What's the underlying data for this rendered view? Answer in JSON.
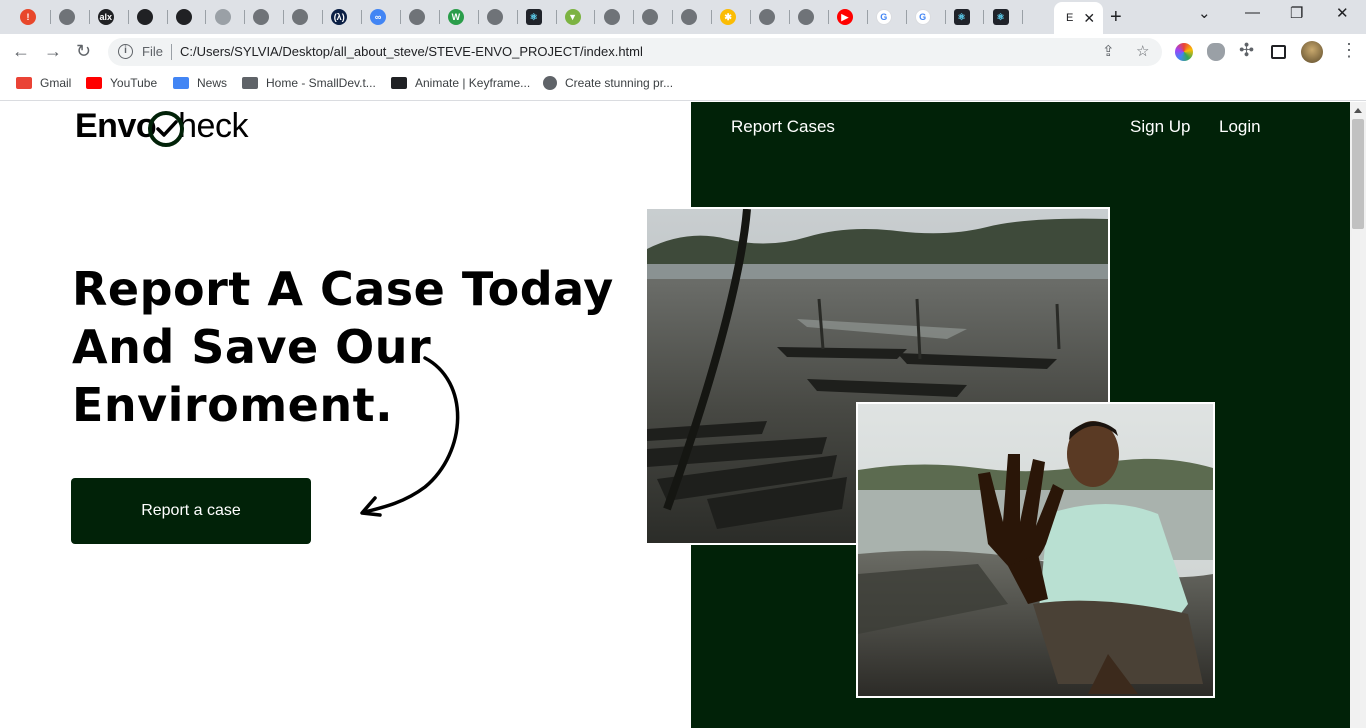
{
  "browser": {
    "active_tab_title": "E",
    "url_scheme_label": "File",
    "url": "C:/Users/SYLVIA/Desktop/all_about_steve/STEVE-ENVO_PROJECT/index.html",
    "tabs": [
      {
        "icon": "brave-icon",
        "color": "#e8472b",
        "glyph": "!"
      },
      {
        "icon": "globe-icon",
        "color": "#6f7378",
        "glyph": ""
      },
      {
        "icon": "alx-icon",
        "color": "#202124",
        "glyph": "alx"
      },
      {
        "icon": "github-icon",
        "color": "#202124",
        "glyph": ""
      },
      {
        "icon": "github-icon",
        "color": "#202124",
        "glyph": ""
      },
      {
        "icon": "figma-icon",
        "color": "#9aa0a6",
        "glyph": ""
      },
      {
        "icon": "globe-icon",
        "color": "#6f7378",
        "glyph": ""
      },
      {
        "icon": "globe-icon",
        "color": "#6f7378",
        "glyph": ""
      },
      {
        "icon": "codepen-icon",
        "color": "#0b1f44",
        "glyph": "(λ)"
      },
      {
        "icon": "infinity-icon",
        "color": "#4285f4",
        "glyph": "∞"
      },
      {
        "icon": "globe-icon",
        "color": "#6f7378",
        "glyph": ""
      },
      {
        "icon": "webflow-icon",
        "color": "#2a9d4a",
        "glyph": "W"
      },
      {
        "icon": "globe-icon",
        "color": "#6f7378",
        "glyph": ""
      },
      {
        "icon": "react-icon",
        "color": "#20232a",
        "glyph": "⚛"
      },
      {
        "icon": "download-icon",
        "color": "#7cb342",
        "glyph": "▼"
      },
      {
        "icon": "globe-icon",
        "color": "#6f7378",
        "glyph": ""
      },
      {
        "icon": "globe-icon",
        "color": "#6f7378",
        "glyph": ""
      },
      {
        "icon": "globe-icon",
        "color": "#6f7378",
        "glyph": ""
      },
      {
        "icon": "colorful-icon",
        "color": "#fbbc04",
        "glyph": "✱"
      },
      {
        "icon": "globe-icon",
        "color": "#6f7378",
        "glyph": ""
      },
      {
        "icon": "globe-icon",
        "color": "#6f7378",
        "glyph": ""
      },
      {
        "icon": "youtube-icon",
        "color": "#ff0000",
        "glyph": "▶"
      },
      {
        "icon": "google-icon",
        "color": "#ffffff",
        "glyph": "G"
      },
      {
        "icon": "google-icon",
        "color": "#ffffff",
        "glyph": "G"
      },
      {
        "icon": "react-icon",
        "color": "#20232a",
        "glyph": "⚛"
      },
      {
        "icon": "react-icon",
        "color": "#20232a",
        "glyph": "⚛"
      }
    ]
  },
  "bookmarks": [
    {
      "label": "Gmail",
      "icon": "gmail-icon",
      "color": "#ea4335"
    },
    {
      "label": "YouTube",
      "icon": "youtube-icon",
      "color": "#ff0000"
    },
    {
      "label": "News",
      "icon": "news-icon",
      "color": "#4285f4"
    },
    {
      "label": "Home - SmallDev.t...",
      "icon": "smalldev-icon",
      "color": "#5f6368"
    },
    {
      "label": "Animate | Keyframe...",
      "icon": "keyframes-icon",
      "color": "#202124"
    },
    {
      "label": "Create stunning pr...",
      "icon": "globe-icon",
      "color": "#5f6368"
    }
  ],
  "site": {
    "logo_part1": "Envo",
    "logo_part2": "heck",
    "nav": {
      "report_cases": "Report Cases",
      "sign_up": "Sign Up",
      "login": "Login"
    },
    "hero_title": "Report A Case Today And Save Our Enviroment.",
    "cta_label": "Report a case",
    "colors": {
      "brand_green": "#012208",
      "white": "#ffffff"
    }
  }
}
